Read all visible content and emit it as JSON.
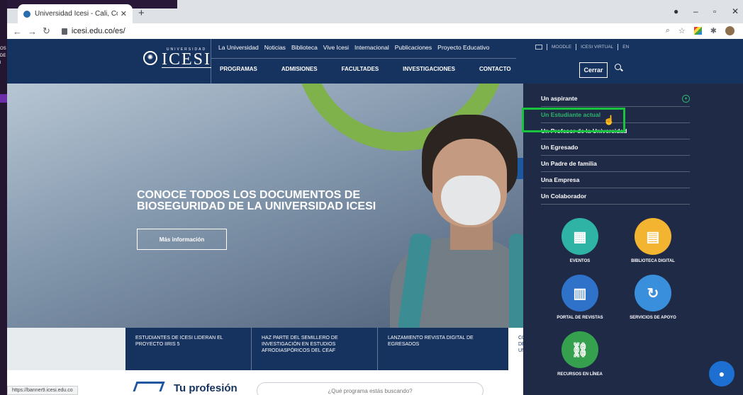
{
  "browser": {
    "tab_title": "Universidad Icesi - Cali, Colombia",
    "tab_close": "✕",
    "new_tab": "+",
    "url": "icesi.edu.co/es/",
    "status_url": "https://banner9.icesi.edu.co"
  },
  "header": {
    "logo_small": "UNIVERSIDAD",
    "logo_big": "ICESI",
    "top_links": [
      "La Universidad",
      "Noticias",
      "Biblioteca",
      "Vive Icesi",
      "Internacional",
      "Publicaciones",
      "Proyecto Educativo"
    ],
    "util_links": [
      "MOODLE",
      "ICESI VIRTUAL",
      "EN"
    ],
    "main_nav": [
      "PROGRAMAS",
      "ADMISIONES",
      "FACULTADES",
      "INVESTIGACIONES",
      "CONTACTO"
    ],
    "close_label": "Cerrar"
  },
  "hero": {
    "title": "CONOCE TODOS LOS DOCUMENTOS DE BIOSEGURIDAD DE LA UNIVERSIDAD ICESI",
    "button": "Más información"
  },
  "news": [
    "ESTUDIANTES DE ICESI LIDERAN EL PROYECTO IIRIS 5",
    "HAZ PARTE DEL SEMILLERO DE INVESTIGACIÓN EN ESTUDIOS AFRODIASPÓRICOS DEL CEAF",
    "LANZAMIENTO REVISTA DIGITAL DE EGRESADOS"
  ],
  "news_partial": "CO DE UN",
  "bottom": {
    "title": "Tu profesión",
    "search_placeholder": "¿Qué programa estás buscando?"
  },
  "dropdown": {
    "items": [
      "Un aspirante",
      "Un Estudiante actual",
      "Un Profesor de la Universidad",
      "Un Egresado",
      "Un Padre de familia",
      "Una Empresa",
      "Un Colaborador"
    ],
    "tiles": [
      {
        "label": "EVENTOS",
        "icon": "calendar-icon",
        "color": "#2fb3a4"
      },
      {
        "label": "BIBLIOTECA DIGITAL",
        "icon": "book-icon",
        "color": "#f2b431"
      },
      {
        "label": "PORTAL DE REVISTAS",
        "icon": "magazine-icon",
        "color": "#2e72c9"
      },
      {
        "label": "SERVICIOS DE APOYO",
        "icon": "support-24h-icon",
        "color": "#3a8fdc"
      },
      {
        "label": "RECURSOS EN LÍNEA",
        "icon": "link-icon",
        "color": "#35a14f"
      }
    ]
  },
  "background_desktop": [
    "OS I",
    "DE",
    "l"
  ]
}
